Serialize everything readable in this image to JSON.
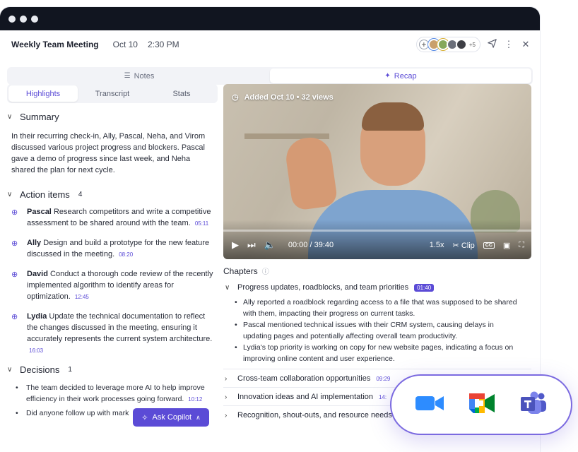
{
  "meeting": {
    "title": "Weekly Team Meeting",
    "date": "Oct 10",
    "time": "2:30 PM",
    "participants_extra": "+5",
    "avatar_colors": [
      "#c9a06d",
      "#86a85a",
      "#6b6f7a",
      "#3e3f45"
    ]
  },
  "top_tabs": [
    {
      "label": "Notes",
      "icon": "notes-icon",
      "active": false
    },
    {
      "label": "Recap",
      "icon": "sparkle-icon",
      "active": true
    }
  ],
  "sub_tabs": [
    {
      "label": "Highlights",
      "active": true
    },
    {
      "label": "Transcript",
      "active": false
    },
    {
      "label": "Stats",
      "active": false
    }
  ],
  "summary": {
    "heading": "Summary",
    "text": "In their recurring check-in, Ally, Pascal, Neha, and Virom discussed various project progress and blockers. Pascal gave a demo of progress since last week, and Neha shared the plan for next cycle."
  },
  "action_items": {
    "heading": "Action items",
    "count": "4",
    "items": [
      {
        "name": "Pascal",
        "text": "Research competitors and write a competitive assessment to be shared around with the team.",
        "ts": "05:11"
      },
      {
        "name": "Ally",
        "text": "Design and build a prototype for the new feature discussed in the meeting.",
        "ts": "08:20"
      },
      {
        "name": "David",
        "text": "Conduct a thorough code review of the recently implemented algorithm to identify areas for optimization.",
        "ts": "12:45"
      },
      {
        "name": "Lydia",
        "text": "Update the technical documentation to reflect the changes discussed in the meeting, ensuring it accurately represents the current system architecture.",
        "ts": "16:03"
      }
    ]
  },
  "decisions": {
    "heading": "Decisions",
    "count": "1",
    "items": [
      {
        "text": "The team decided to leverage more AI to help improve efficiency in their work processes going forward.",
        "ts": "10:12"
      },
      {
        "text": "Did anyone follow up with mark",
        "ts": ""
      }
    ]
  },
  "copilot": {
    "label": "Ask Copilot"
  },
  "video": {
    "meta": "Added Oct 10 • 32 views",
    "current_time": "00:00",
    "separator": "/",
    "duration": "39:40",
    "speed": "1.5x",
    "clip_label": "Clip",
    "cc_label": "CC",
    "progress": 0.0
  },
  "chapters": {
    "heading": "Chapters",
    "list": [
      {
        "title": "Progress updates, roadblocks, and team priorities",
        "ts": "01:40",
        "expanded": true,
        "bullets": [
          "Ally reported a roadblock regarding access to a file that was supposed to be shared with them, impacting their progress on current tasks.",
          "Pascal mentioned technical issues with their CRM system, causing delays in updating pages and potentially affecting overall team productivity.",
          "Lydia's top priority is working on copy for new website pages, indicating a focus on improving online content and user experience."
        ]
      },
      {
        "title": "Cross-team collaboration opportunities",
        "ts": "09:29",
        "expanded": false
      },
      {
        "title": "Innovation ideas and AI implementation",
        "ts": "14:",
        "expanded": false
      },
      {
        "title": "Recognition, shout-outs, and resource needs",
        "ts": "",
        "expanded": false
      }
    ]
  },
  "integrations": [
    "zoom-icon",
    "google-meet-icon",
    "microsoft-teams-icon"
  ],
  "colors": {
    "accent": "#5b4bd6",
    "titlebar": "#111520"
  }
}
